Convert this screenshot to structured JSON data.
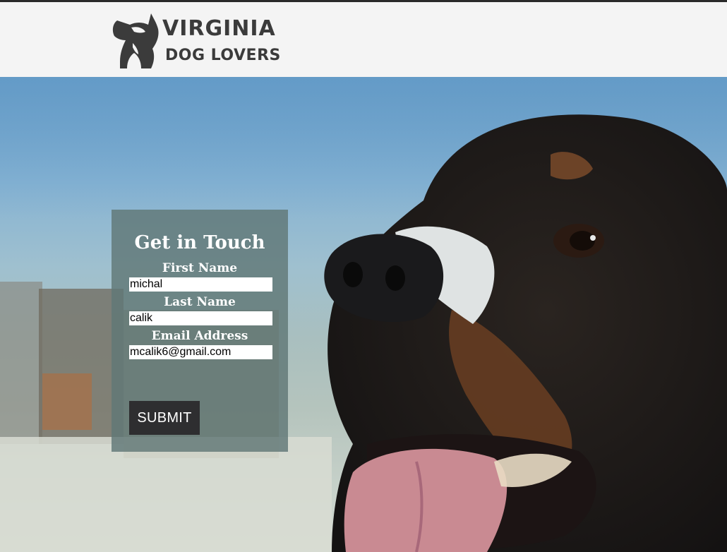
{
  "header": {
    "brand_line1": "VIRGINIA",
    "brand_line2": "DOG LOVERS",
    "logo_icon": "dog-head-icon"
  },
  "contact_form": {
    "title": "Get in Touch",
    "first_name": {
      "label": "First Name",
      "value": "michal"
    },
    "last_name": {
      "label": "Last Name",
      "value": "calik"
    },
    "email": {
      "label": "Email Address",
      "value": "mcalik6@gmail.com"
    },
    "submit_label": "SUBMIT"
  },
  "colors": {
    "header_bg": "#f4f4f4",
    "brand_text": "#3b3b3b",
    "form_bg": "#607876",
    "button_bg": "#2e2e30"
  }
}
